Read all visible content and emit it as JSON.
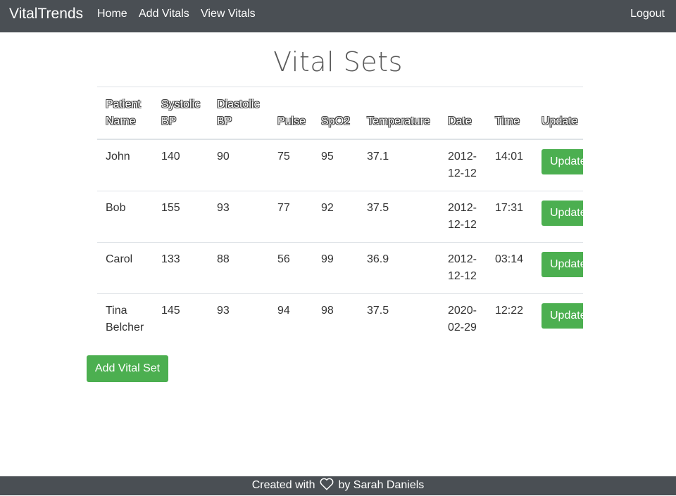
{
  "navbar": {
    "brand": "VitalTrends",
    "links": [
      "Home",
      "Add Vitals",
      "View Vitals"
    ],
    "logout": "Logout"
  },
  "page": {
    "title": "Vital Sets"
  },
  "table": {
    "headers": [
      "Patient Name",
      "Systolic BP",
      "Diastolic BP",
      "Pulse",
      "SpO2",
      "Temperature",
      "Date",
      "Time",
      "Update"
    ],
    "rows": [
      {
        "name": "John",
        "systolic": "140",
        "diastolic": "90",
        "pulse": "75",
        "spo2": "95",
        "temperature": "37.1",
        "date": "2012-12-12",
        "time": "14:01",
        "update": "Update"
      },
      {
        "name": "Bob",
        "systolic": "155",
        "diastolic": "93",
        "pulse": "77",
        "spo2": "92",
        "temperature": "37.5",
        "date": "2012-12-12",
        "time": "17:31",
        "update": "Update"
      },
      {
        "name": "Carol",
        "systolic": "133",
        "diastolic": "88",
        "pulse": "56",
        "spo2": "99",
        "temperature": "36.9",
        "date": "2012-12-12",
        "time": "03:14",
        "update": "Update"
      },
      {
        "name": "Tina Belcher",
        "systolic": "145",
        "diastolic": "93",
        "pulse": "94",
        "spo2": "98",
        "temperature": "37.5",
        "date": "2020-02-29",
        "time": "12:22",
        "update": "Update"
      }
    ]
  },
  "actions": {
    "add_label": "Add Vital Set"
  },
  "footer": {
    "prefix": "Created with",
    "icon": "heart-icon",
    "suffix": "by Sarah Daniels"
  },
  "colors": {
    "navbar_bg": "#4a4f54",
    "button_green": "#4caf50"
  }
}
